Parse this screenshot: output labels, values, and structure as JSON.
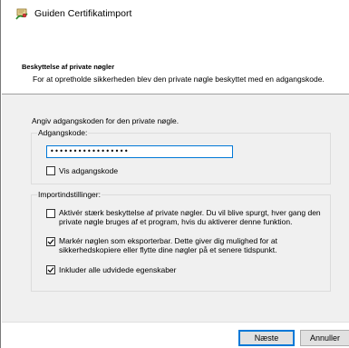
{
  "window": {
    "title": "Guiden Certifikatimport"
  },
  "header": {
    "title": "Beskyttelse af private nøgler",
    "description": "For at opretholde sikkerheden blev den private nøgle beskyttet med en adgangskode."
  },
  "main": {
    "prompt": "Angiv adgangskoden for den private nøgle.",
    "password_group": {
      "legend": "Adgangskode:",
      "value": "•••••••••••••••••",
      "show_password": {
        "label": "Vis adgangskode",
        "checked": false
      }
    },
    "options_group": {
      "legend": "Importindstillinger:",
      "options": [
        {
          "line1": "Aktivér stærk beskyttelse af private nøgler. Du vil blive spurgt, hver gang den",
          "line2": "private nøgle bruges af et program, hvis du aktiverer denne funktion.",
          "checked": false
        },
        {
          "line1": "Markér nøglen som eksporterbar. Dette giver dig mulighed for at",
          "line2": "sikkerhedskopiere eller flytte dine nøgler på et senere tidspunkt.",
          "checked": true
        },
        {
          "line1": "Inkluder alle udvidede egenskaber",
          "checked": true
        }
      ]
    }
  },
  "footer": {
    "next_label": "Næste",
    "cancel_label": "Annuller"
  },
  "colors": {
    "accent": "#0078d7",
    "content_bg": "#f0f0f0"
  },
  "icons": {
    "title": "certificate-icon"
  }
}
